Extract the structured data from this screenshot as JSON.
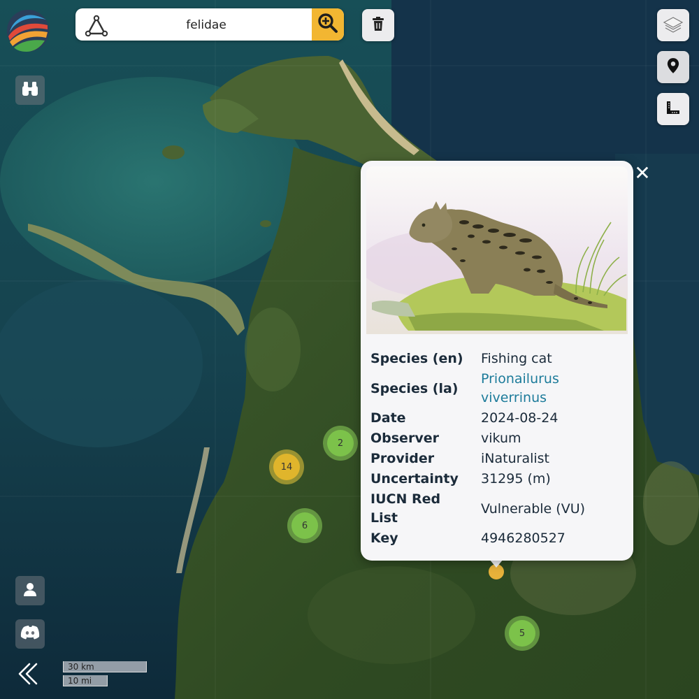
{
  "search": {
    "value": "felidae"
  },
  "clusters": [
    {
      "count": "2",
      "color": "green"
    },
    {
      "count": "14",
      "color": "yellow"
    },
    {
      "count": "6",
      "color": "green"
    },
    {
      "count": "5",
      "color": "green"
    }
  ],
  "popup": {
    "close_symbol": "✕",
    "fields": {
      "species_en": {
        "label": "Species (en)",
        "value": "Fishing cat"
      },
      "species_la": {
        "label": "Species (la)",
        "value": "Prionailurus viverrinus"
      },
      "date": {
        "label": "Date",
        "value": "2024-08-24"
      },
      "observer": {
        "label": "Observer",
        "value": "vikum"
      },
      "provider": {
        "label": "Provider",
        "value": "iNaturalist"
      },
      "uncertainty": {
        "label": "Uncertainty",
        "value": "31295 (m)"
      },
      "iucn": {
        "label": "IUCN Red List",
        "value": "Vulnerable (VU)"
      },
      "key": {
        "label": "Key",
        "value": "4946280527"
      }
    }
  },
  "scale": {
    "km": "30 km",
    "mi": "10 mi"
  },
  "icons": {
    "logo": "app-logo",
    "draw": "polygon-draw-icon",
    "search": "zoom-search-icon",
    "trash": "trash-icon",
    "layers": "layers-icon",
    "pin": "location-pin-icon",
    "ruler": "measure-icon",
    "binoculars": "binoculars-icon",
    "user": "user-icon",
    "discord": "discord-icon",
    "collapse": "double-chevron-icon"
  },
  "colors": {
    "accent": "#f2b632",
    "link": "#1c7b9a",
    "cluster_green": "#7cc24a",
    "cluster_yellow": "#e0b52c"
  }
}
